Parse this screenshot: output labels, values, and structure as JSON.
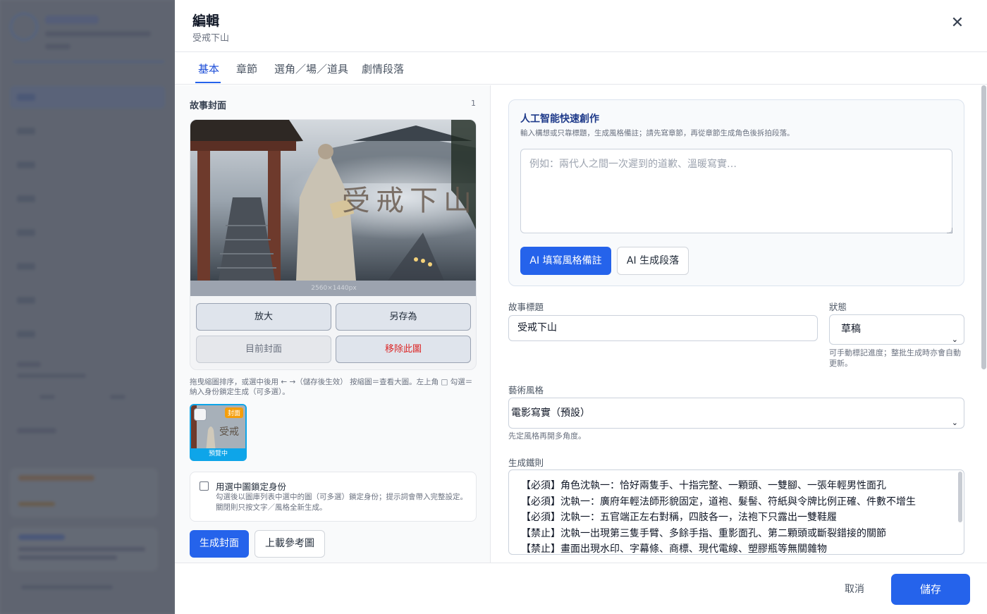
{
  "drawer": {
    "title": "編輯",
    "subtitle": "受戒下山",
    "close_icon": "close-icon"
  },
  "tabs": [
    {
      "label": "基本",
      "active": true
    },
    {
      "label": "章節",
      "active": false
    },
    {
      "label": "選角／場／道具",
      "active": false
    },
    {
      "label": "劇情段落",
      "active": false
    }
  ],
  "cover": {
    "section_label": "故事封面",
    "count": "1",
    "image_title": "受戒下山",
    "dims": "2560×1440px",
    "buttons": {
      "zoom": "放大",
      "save_as": "另存為",
      "current": "目前封面",
      "remove": "移除此圖"
    },
    "hint": "拖曳縮圖排序，或選中後用 ← →（儲存後生效） 按縮圖＝查看大圖。左上角 □ 勾選＝納入身份鎖定生成（可多選）。",
    "thumb": {
      "badge": "封面",
      "caption": "預覽中",
      "art_text": "受戒"
    },
    "lock": {
      "title": "用選中圖鎖定身份",
      "desc": "勾選後以圖庫列表中選中的圖（可多選）鎖定身份；提示詞會帶入完整設定。關閉則只按文字／風格全新生成。"
    },
    "generate_button": "生成封面",
    "upload_button": "上載參考圖"
  },
  "ai": {
    "title": "人工智能快速創作",
    "desc": "輸入構想或只靠標題，生成風格備註；請先寫章節，再從章節生成角色後拆拍段落。",
    "placeholder": "例如：兩代人之間一次遲到的道歉、溫暖寫實…",
    "fill_button": "AI 填寫風格備註",
    "gen_button": "AI 生成段落"
  },
  "form": {
    "title_label": "故事標題",
    "title_value": "受戒下山",
    "status_label": "狀態",
    "status_value": "草稿",
    "status_help": "可手動標記進度；整批生成時亦會自動更新。",
    "style_label": "藝術風格",
    "style_value": "電影寫實（預設）",
    "style_help": "先定風格再開多角度。",
    "rules_label": "生成鐵則",
    "rules": [
      "【必須】角色沈執一：恰好兩隻手、十指完整、一顆頭、一雙腳、一張年輕男性面孔",
      "【必須】沈執一：廣府年輕法師形貌固定，道袍、髮髻、符紙與令牌比例正確、件數不增生",
      "【必須】沈執一：五官端正左右對稱，四肢各一，法袍下只露出一雙鞋履",
      "【禁止】沈執一出現第三隻手臂、多餘手指、重影面孔、第二顆頭或斷裂錯接的關節",
      "【禁止】畫面出現水印、字幕條、商標、現代電線、塑膠瓶等無關雜物"
    ]
  },
  "footer": {
    "cancel": "取消",
    "save": "儲存"
  },
  "colors": {
    "accent": "#2563eb",
    "danger": "#dc2626",
    "badge": "#f59e0b",
    "thumb_border": "#0ea5e9"
  }
}
